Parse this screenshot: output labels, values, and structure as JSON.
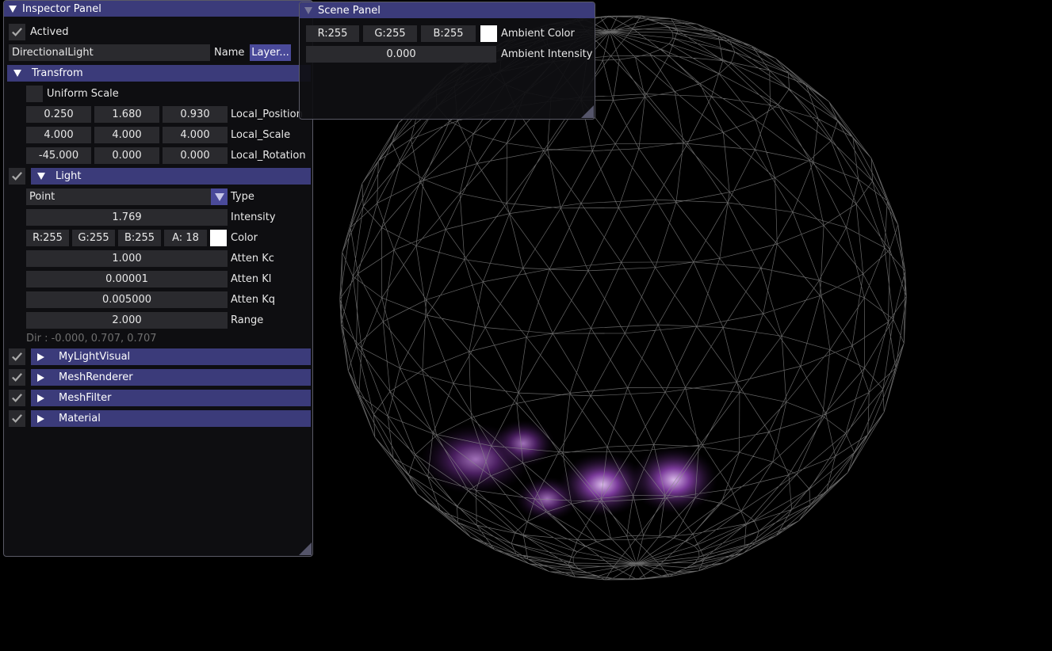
{
  "inspector": {
    "title": "Inspector Panel",
    "actived_label": "Actived",
    "actived": true,
    "name_value": "DirectionalLight",
    "name_label": "Name",
    "layer_button": "Layer...",
    "transform": {
      "header": "Transfrom",
      "uniform_scale_label": "Uniform Scale",
      "uniform_scale": false,
      "rows": [
        {
          "values": [
            "0.250",
            "1.680",
            "0.930"
          ],
          "label": "Local_Position"
        },
        {
          "values": [
            "4.000",
            "4.000",
            "4.000"
          ],
          "label": "Local_Scale"
        },
        {
          "values": [
            "-45.000",
            "0.000",
            "0.000"
          ],
          "label": "Local_Rotation"
        }
      ]
    },
    "light": {
      "header": "Light",
      "enabled": true,
      "type_value": "Point",
      "type_label": "Type",
      "intensity_value": "1.769",
      "intensity_label": "Intensity",
      "color": {
        "r": "R:255",
        "g": "G:255",
        "b": "B:255",
        "a": "A: 18",
        "label": "Color",
        "swatch": "#ffffff"
      },
      "atten_kc_value": "1.000",
      "atten_kc_label": "Atten Kc",
      "atten_kl_value": "0.00001",
      "atten_kl_label": "Atten Kl",
      "atten_kq_value": "0.005000",
      "atten_kq_label": "Atten Kq",
      "range_value": "2.000",
      "range_label": "Range",
      "dir_text": "Dir : -0.000, 0.707, 0.707"
    },
    "components": [
      {
        "label": "MyLightVisual",
        "enabled": true
      },
      {
        "label": "MeshRenderer",
        "enabled": true
      },
      {
        "label": "MeshFilter",
        "enabled": true
      },
      {
        "label": "Material",
        "enabled": true
      }
    ]
  },
  "scene": {
    "title": "Scene Panel",
    "ambient_color": {
      "r": "R:255",
      "g": "G:255",
      "b": "B:255",
      "label": "Ambient Color",
      "swatch": "#ffffff"
    },
    "ambient_intensity_value": "0.000",
    "ambient_intensity_label": "Ambient Intensity"
  },
  "colors": {
    "header_bg": "#3b3b7a",
    "field_bg": "#2a2a2e",
    "accent_button": "#4a4a9a",
    "wireframe": "#8a8a8a",
    "glow_purple": "#7a3a9a"
  }
}
